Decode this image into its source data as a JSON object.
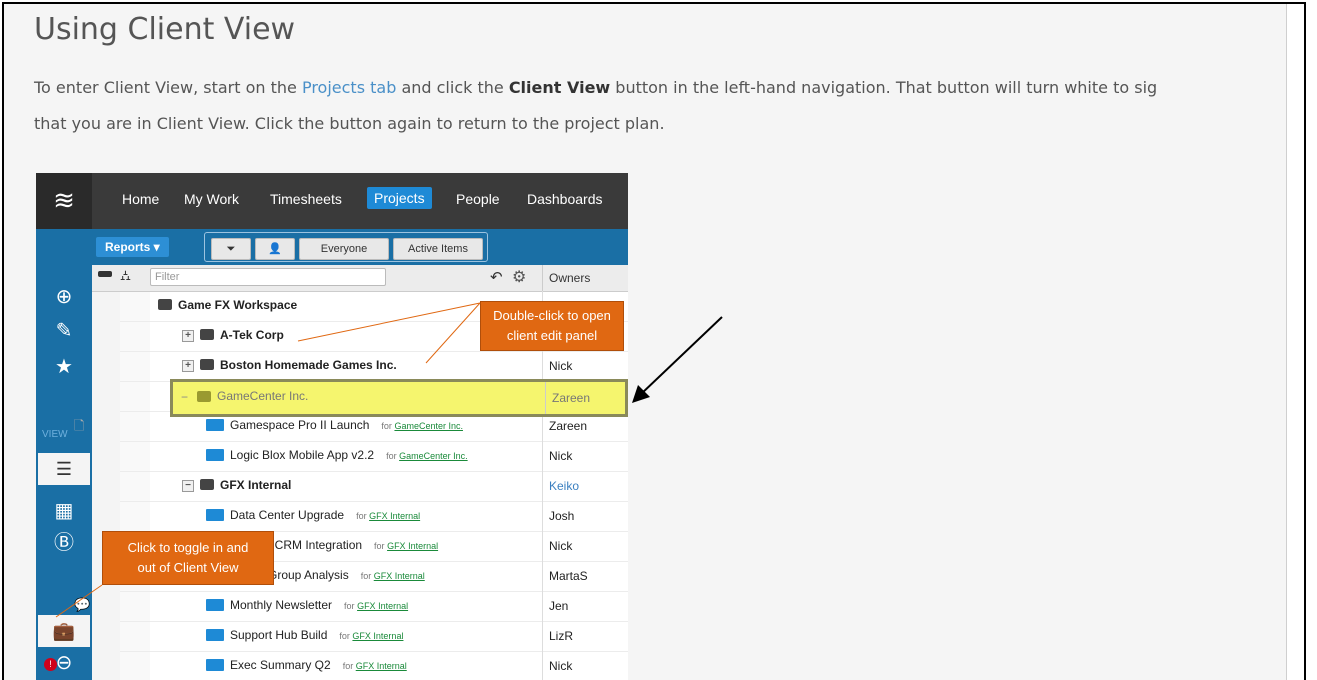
{
  "article": {
    "title": "Using Client View",
    "p1_pre": "To enter Client View, start on the ",
    "p1_link": "Projects tab",
    "p1_mid": " and click the ",
    "p1_bold": "Client View",
    "p1_post": " button in the left-hand navigation.  That button will turn white to sig",
    "p2": "that you are in Client View. Click the button again to return to the project plan."
  },
  "app": {
    "logo": "≋",
    "nav": [
      "Home",
      "My Work",
      "Timesheets",
      "Projects",
      "People",
      "Dashboards"
    ],
    "active_nav": "Projects",
    "reports_label": "Reports ▾",
    "toolbar": {
      "everyone": "Everyone",
      "active_items": "Active Items"
    },
    "filter_placeholder": "Filter",
    "owners_header": "Owners",
    "sidebar_view_label": "VIEW",
    "workspace": "Game FX Workspace",
    "rows": [
      {
        "name": "A-Tek Corp",
        "owner": "",
        "for": ""
      },
      {
        "name": "Boston Homemade Games Inc.",
        "owner": "Nick",
        "for": ""
      },
      {
        "name": "GameCenter Inc.",
        "owner": "Zareen",
        "for": ""
      },
      {
        "name": "Gamespace Pro II Launch",
        "owner": "Zareen",
        "for": "GameCenter Inc."
      },
      {
        "name": "Logic Blox Mobile App v2.2",
        "owner": "Nick",
        "for": "GameCenter Inc."
      },
      {
        "name": "GFX Internal",
        "owner": "Keiko",
        "for": ""
      },
      {
        "name": "Data Center Upgrade",
        "owner": "Josh",
        "for": "GFX Internal"
      },
      {
        "name": "/ CRM Integration",
        "owner": "Nick",
        "for": "GFX Internal"
      },
      {
        "name": "Group Analysis",
        "owner": "MartaS",
        "for": "GFX Internal"
      },
      {
        "name": "Monthly Newsletter",
        "owner": "Jen",
        "for": "GFX Internal"
      },
      {
        "name": "Support Hub Build",
        "owner": "LizR",
        "for": "GFX Internal"
      },
      {
        "name": "Exec Summary Q2",
        "owner": "Nick",
        "for": "GFX Internal"
      }
    ],
    "for_prefix": "for ",
    "callout_dblclick_1": "Double-click to open",
    "callout_dblclick_2": "client edit panel",
    "callout_toggle_1": "Click to toggle in and",
    "callout_toggle_2": "out of Client View"
  },
  "colors": {
    "highlight": "#f5f56e",
    "callout": "#e06812",
    "nav_blue": "#1a6fa5",
    "owner_link": "#3a7fc0"
  }
}
